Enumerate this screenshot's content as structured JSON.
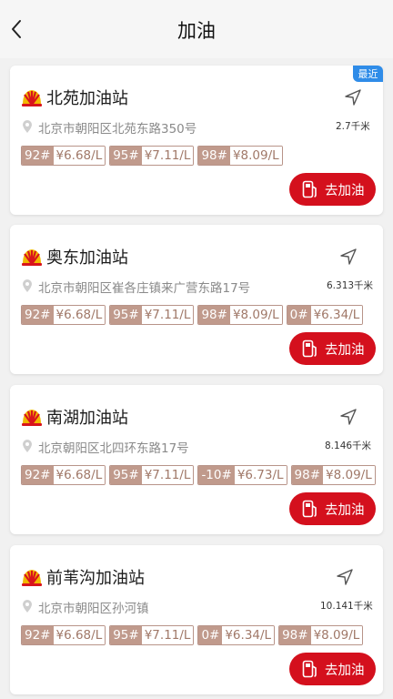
{
  "header": {
    "title": "加油"
  },
  "icons": {
    "back": "chevron-left-icon",
    "navigate": "navigation-arrow-icon",
    "location": "location-pin-icon",
    "pump": "fuel-pump-icon",
    "logo": "petrochina-logo"
  },
  "colors": {
    "accent": "#d4101d",
    "badge": "#2f8ce8",
    "grade_bg": "#c09a8c",
    "price_text": "#a07868"
  },
  "go_label": "去加油",
  "stations": [
    {
      "name": "北苑加油站",
      "badge": "最近",
      "address": "北京市朝阳区北苑东路350号",
      "distance": "2.7千米",
      "prices": [
        {
          "grade": "92#",
          "price": "¥6.68/L"
        },
        {
          "grade": "95#",
          "price": "¥7.11/L"
        },
        {
          "grade": "98#",
          "price": "¥8.09/L"
        }
      ]
    },
    {
      "name": "奥东加油站",
      "address": "北京市朝阳区崔各庄镇来广营东路17号",
      "distance": "6.313千米",
      "prices": [
        {
          "grade": "92#",
          "price": "¥6.68/L"
        },
        {
          "grade": "95#",
          "price": "¥7.11/L"
        },
        {
          "grade": "98#",
          "price": "¥8.09/L"
        },
        {
          "grade": "0#",
          "price": "¥6.34/L"
        }
      ]
    },
    {
      "name": "南湖加油站",
      "address": "北京朝阳区北四环东路17号",
      "distance": "8.146千米",
      "prices": [
        {
          "grade": "92#",
          "price": "¥6.68/L"
        },
        {
          "grade": "95#",
          "price": "¥7.11/L"
        },
        {
          "grade": "-10#",
          "price": "¥6.73/L"
        },
        {
          "grade": "98#",
          "price": "¥8.09/L"
        }
      ]
    },
    {
      "name": "前苇沟加油站",
      "address": "北京市朝阳区孙河镇",
      "distance": "10.141千米",
      "prices": [
        {
          "grade": "92#",
          "price": "¥6.68/L"
        },
        {
          "grade": "95#",
          "price": "¥7.11/L"
        },
        {
          "grade": "0#",
          "price": "¥6.34/L"
        },
        {
          "grade": "98#",
          "price": "¥8.09/L"
        }
      ]
    }
  ]
}
